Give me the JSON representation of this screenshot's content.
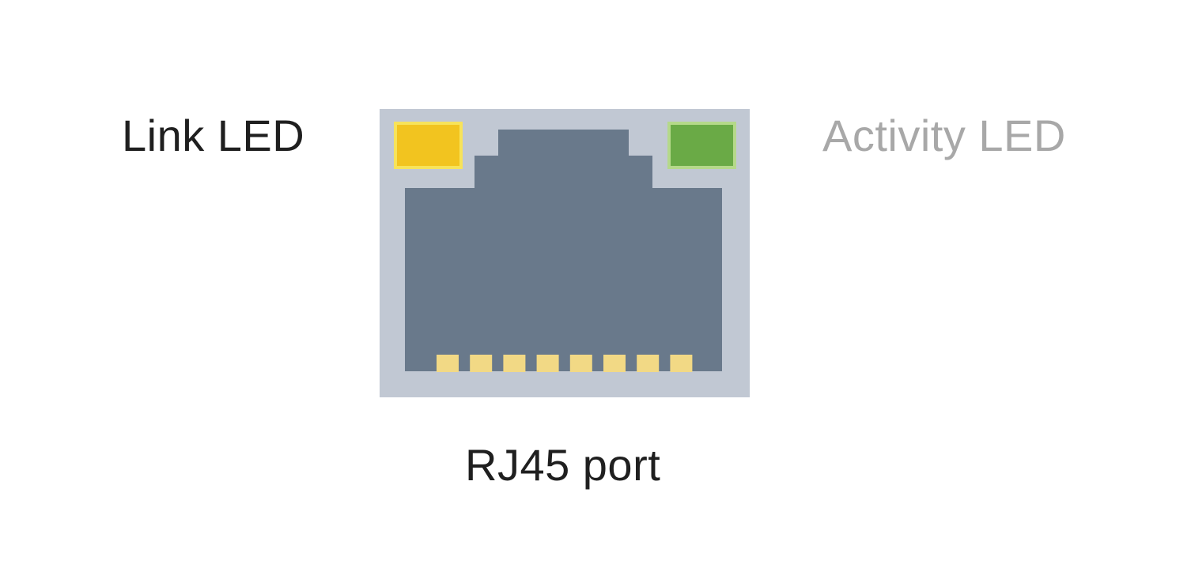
{
  "labels": {
    "link_led": "Link LED",
    "activity_led": "Activity LED",
    "port": "RJ45 port"
  },
  "colors": {
    "port_frame": "#c1c8d3",
    "port_opening": "#69798b",
    "link_led": "#f2c41f",
    "link_led_border": "#f7e35a",
    "activity_led": "#6aaa46",
    "activity_led_border": "#b5d98a",
    "contact_pins": "#f2d985",
    "link_label_text": "#1f1f1f",
    "activity_label_text": "#a8a8a8"
  },
  "pins": {
    "count": 8
  }
}
